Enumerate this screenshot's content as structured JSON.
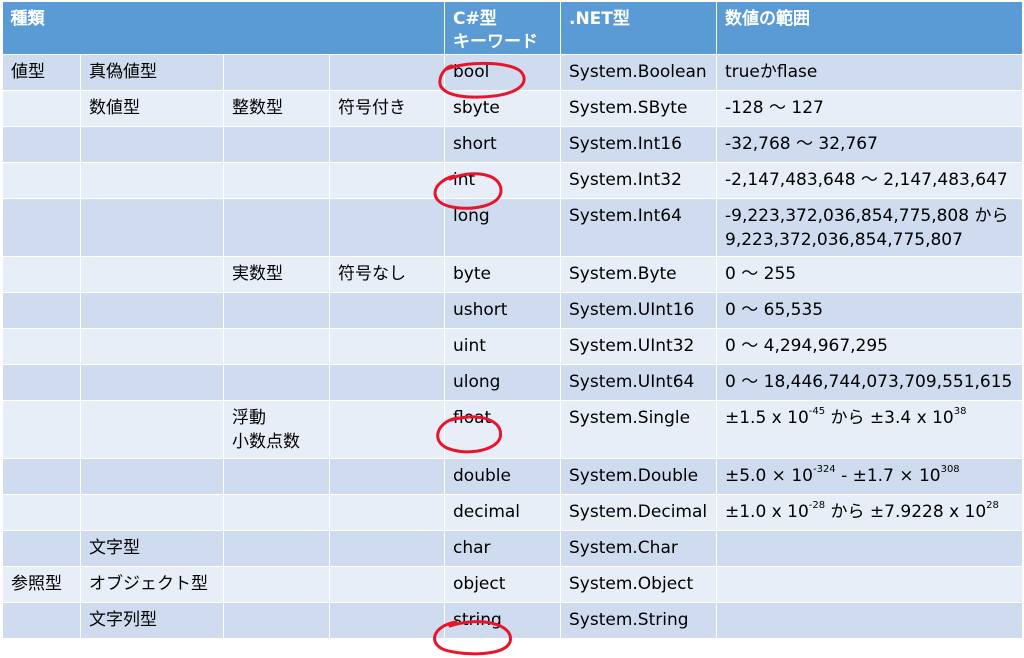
{
  "header": {
    "kind": "種類",
    "keyword_line1": "C#型",
    "keyword_line2": "キーワード",
    "dotnet": ".NET型",
    "range": "数値の範囲"
  },
  "rows": [
    {
      "c1": "値型",
      "c2": "真偽値型",
      "c3": "",
      "c4": "",
      "kw": "bool",
      "net": "System.Boolean",
      "range": "trueかflase"
    },
    {
      "c1": "",
      "c2": "数値型",
      "c3": "整数型",
      "c4": "符号付き",
      "kw": "sbyte",
      "net": "System.SByte",
      "range": "-128 〜 127"
    },
    {
      "c1": "",
      "c2": "",
      "c3": "",
      "c4": "",
      "kw": "short",
      "net": "System.Int16",
      "range": "-32,768 〜 32,767"
    },
    {
      "c1": "",
      "c2": "",
      "c3": "",
      "c4": "",
      "kw": "int",
      "net": "System.Int32",
      "range": "-2,147,483,648 〜 2,147,483,647"
    },
    {
      "c1": "",
      "c2": "",
      "c3": "",
      "c4": "",
      "kw": "long",
      "net": "System.Int64",
      "range": "-9,223,372,036,854,775,808 から",
      "range2": "9,223,372,036,854,775,807"
    },
    {
      "c1": "",
      "c2": "",
      "c3": "実数型",
      "c4": "符号なし",
      "kw": "byte",
      "net": "System.Byte",
      "range": "0 〜 255"
    },
    {
      "c1": "",
      "c2": "",
      "c3": "",
      "c4": "",
      "kw": "ushort",
      "net": "System.UInt16",
      "range": "0 〜 65,535"
    },
    {
      "c1": "",
      "c2": "",
      "c3": "",
      "c4": "",
      "kw": "uint",
      "net": "System.UInt32",
      "range": "0 〜 4,294,967,295"
    },
    {
      "c1": "",
      "c2": "",
      "c3": "",
      "c4": "",
      "kw": "ulong",
      "net": "System.UInt64",
      "range": "0 〜 18,446,744,073,709,551,615"
    },
    {
      "c1": "",
      "c2": "",
      "c3": "浮動",
      "c3b": "小数点数",
      "c4": "",
      "kw": "float",
      "net": "System.Single",
      "r_a": "±1.5 x 10",
      "r_e1": "-45",
      "r_b": " から ±3.4 x 10",
      "r_e2": "38"
    },
    {
      "c1": "",
      "c2": "",
      "c3": "",
      "c4": "",
      "kw": "double",
      "net": "System.Double",
      "r_a": "±5.0 × 10",
      "r_e1": "-324",
      "r_b": " - ±1.7 × 10",
      "r_e2": "308"
    },
    {
      "c1": "",
      "c2": "",
      "c3": "",
      "c4": "",
      "kw": "decimal",
      "net": "System.Decimal",
      "r_a": "±1.0 x 10",
      "r_e1": "-28",
      "r_b": " から ±7.9228 x 10",
      "r_e2": "28"
    },
    {
      "c1": "",
      "c2": "文字型",
      "c3": "",
      "c4": "",
      "kw": "char",
      "net": "System.Char",
      "range": ""
    },
    {
      "c1": "参照型",
      "c2": "オブジェクト型",
      "c3": "",
      "c4": "",
      "kw": "object",
      "net": "System.Object",
      "range": ""
    },
    {
      "c1": "",
      "c2": "文字列型",
      "c3": "",
      "c4": "",
      "kw": "string",
      "net": "System.String",
      "range": ""
    }
  ],
  "annotation_color": "#e8142c"
}
